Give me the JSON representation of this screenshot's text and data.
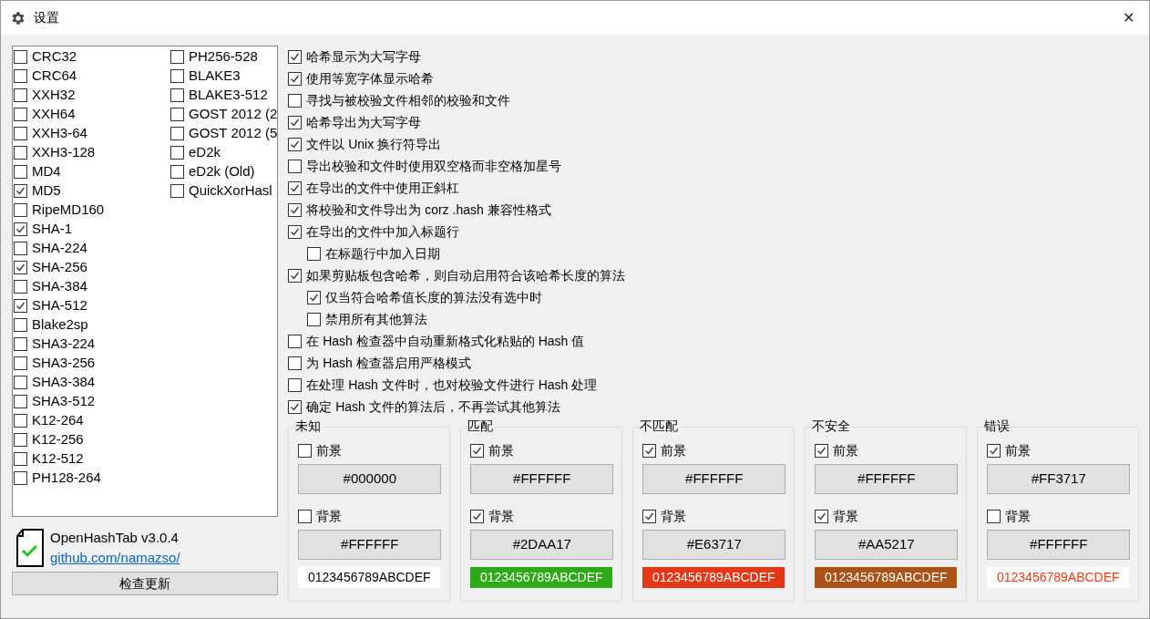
{
  "window": {
    "title": "设置",
    "close": "✕"
  },
  "algorithms": {
    "columns": [
      [
        {
          "label": "CRC32",
          "checked": false
        },
        {
          "label": "CRC64",
          "checked": false
        },
        {
          "label": "XXH32",
          "checked": false
        },
        {
          "label": "XXH64",
          "checked": false
        },
        {
          "label": "XXH3-64",
          "checked": false
        },
        {
          "label": "XXH3-128",
          "checked": false
        },
        {
          "label": "MD4",
          "checked": false
        },
        {
          "label": "MD5",
          "checked": true
        },
        {
          "label": "RipeMD160",
          "checked": false
        },
        {
          "label": "SHA-1",
          "checked": true
        },
        {
          "label": "SHA-224",
          "checked": false
        },
        {
          "label": "SHA-256",
          "checked": true
        },
        {
          "label": "SHA-384",
          "checked": false
        },
        {
          "label": "SHA-512",
          "checked": true
        },
        {
          "label": "Blake2sp",
          "checked": false
        },
        {
          "label": "SHA3-224",
          "checked": false
        },
        {
          "label": "SHA3-256",
          "checked": false
        },
        {
          "label": "SHA3-384",
          "checked": false
        },
        {
          "label": "SHA3-512",
          "checked": false
        },
        {
          "label": "K12-264",
          "checked": false
        },
        {
          "label": "K12-256",
          "checked": false
        },
        {
          "label": "K12-512",
          "checked": false
        },
        {
          "label": "PH128-264",
          "checked": false
        }
      ],
      [
        {
          "label": "PH256-528",
          "checked": false
        },
        {
          "label": "BLAKE3",
          "checked": false
        },
        {
          "label": "BLAKE3-512",
          "checked": false
        },
        {
          "label": "GOST 2012 (2",
          "checked": false
        },
        {
          "label": "GOST 2012 (5",
          "checked": false
        },
        {
          "label": "eD2k",
          "checked": false
        },
        {
          "label": "eD2k (Old)",
          "checked": false
        },
        {
          "label": "QuickXorHasl",
          "checked": false
        }
      ]
    ]
  },
  "about": {
    "name": "OpenHashTab v3.0.4",
    "link": "github.com/namazso/",
    "update_button": "检查更新"
  },
  "options": [
    {
      "label": "哈希显示为大写字母",
      "checked": true
    },
    {
      "label": "使用等宽字体显示哈希",
      "checked": true
    },
    {
      "label": "寻找与被校验文件相邻的校验和文件",
      "checked": false
    },
    {
      "label": "哈希导出为大写字母",
      "checked": true
    },
    {
      "label": "文件以 Unix 换行符导出",
      "checked": true
    },
    {
      "label": "导出校验和文件时使用双空格而非空格加星号",
      "checked": false
    },
    {
      "label": "在导出的文件中使用正斜杠",
      "checked": true
    },
    {
      "label": "将校验和文件导出为 corz .hash 兼容性格式",
      "checked": true
    },
    {
      "label": "在导出的文件中加入标题行",
      "checked": true,
      "children": [
        {
          "label": "在标题行中加入日期",
          "checked": false
        }
      ]
    },
    {
      "label": "如果剪贴板包含哈希，则自动启用符合该哈希长度的算法",
      "checked": true,
      "children": [
        {
          "label": "仅当符合哈希值长度的算法没有选中时",
          "checked": true
        },
        {
          "label": "禁用所有其他算法",
          "checked": false
        }
      ]
    },
    {
      "label": "在 Hash 检查器中自动重新格式化粘贴的 Hash 值",
      "checked": false
    },
    {
      "label": "为 Hash 检查器启用严格模式",
      "checked": false
    },
    {
      "label": "在处理 Hash 文件时，也对校验文件进行 Hash 处理",
      "checked": false
    },
    {
      "label": "确定 Hash 文件的算法后，不再尝试其他算法",
      "checked": true
    }
  ],
  "color_groups": [
    {
      "title": "未知",
      "foreground": {
        "label": "前景",
        "checked": false,
        "value": "#000000"
      },
      "background": {
        "label": "背景",
        "checked": false,
        "value": "#FFFFFF"
      },
      "preview": "0123456789ABCDEF"
    },
    {
      "title": "匹配",
      "foreground": {
        "label": "前景",
        "checked": true,
        "value": "#FFFFFF"
      },
      "background": {
        "label": "背景",
        "checked": true,
        "value": "#2DAA17"
      },
      "preview": "0123456789ABCDEF"
    },
    {
      "title": "不匹配",
      "foreground": {
        "label": "前景",
        "checked": true,
        "value": "#FFFFFF"
      },
      "background": {
        "label": "背景",
        "checked": true,
        "value": "#E63717"
      },
      "preview": "0123456789ABCDEF"
    },
    {
      "title": "不安全",
      "foreground": {
        "label": "前景",
        "checked": true,
        "value": "#FFFFFF"
      },
      "background": {
        "label": "背景",
        "checked": true,
        "value": "#AA5217"
      },
      "preview": "0123456789ABCDEF"
    },
    {
      "title": "错误",
      "foreground": {
        "label": "前景",
        "checked": true,
        "value": "#FF3717"
      },
      "background": {
        "label": "背景",
        "checked": false,
        "value": "#FFFFFF"
      },
      "preview": "0123456789ABCDEF"
    }
  ]
}
